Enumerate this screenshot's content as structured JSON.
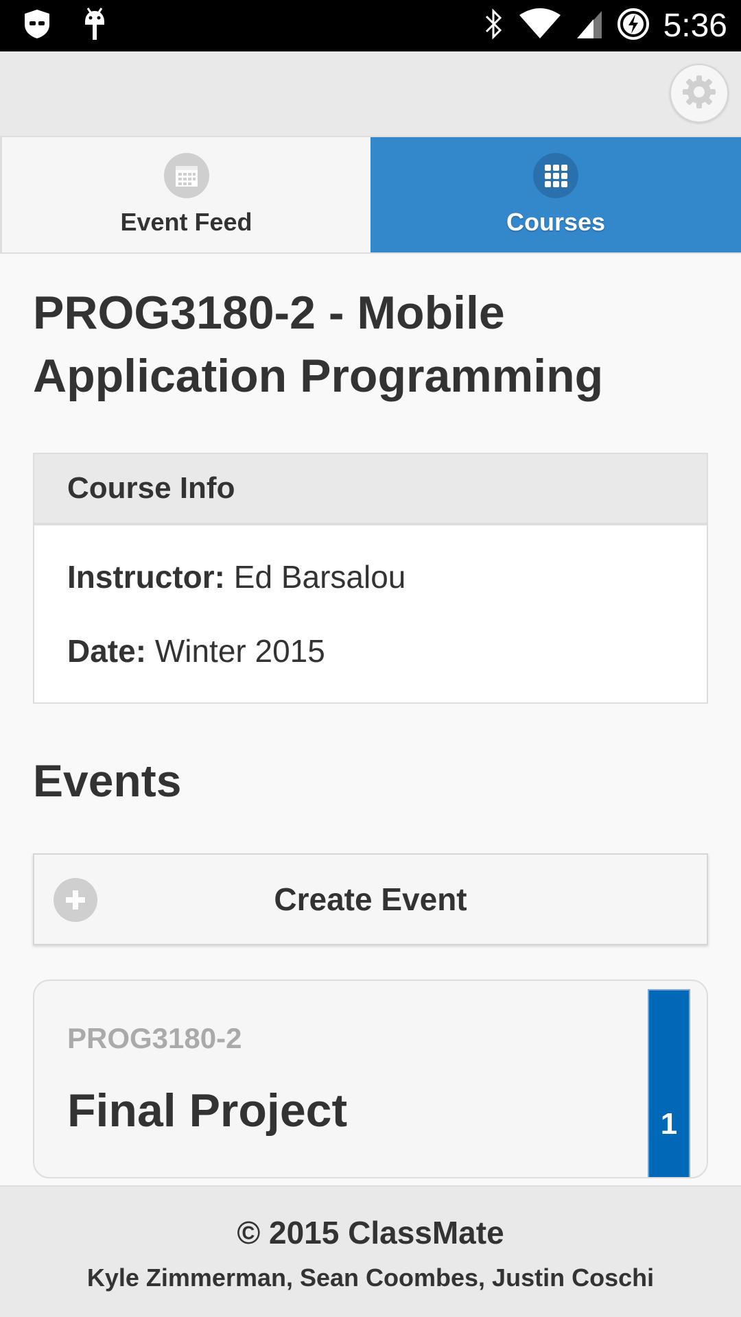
{
  "status_bar": {
    "time": "5:36",
    "icons": [
      "cyanogen-shield-icon",
      "android-icon",
      "bluetooth-icon",
      "wifi-icon",
      "signal-icon",
      "battery-charging-icon"
    ]
  },
  "header": {
    "settings_icon": "gear-icon"
  },
  "tabs": [
    {
      "label": "Event Feed",
      "icon": "calendar-icon",
      "active": false
    },
    {
      "label": "Courses",
      "icon": "grid-icon",
      "active": true
    }
  ],
  "colors": {
    "accent": "#3388cc",
    "badge": "#0068b6"
  },
  "course": {
    "title": "PROG3180-2 - Mobile Application Programming",
    "info_heading": "Course Info",
    "instructor_label": "Instructor:",
    "instructor": "Ed Barsalou",
    "date_label": "Date:",
    "date": "Winter 2015"
  },
  "events": {
    "heading": "Events",
    "create_label": "Create Event",
    "items": [
      {
        "course": "PROG3180-2",
        "name": "Final Project",
        "count": "1"
      }
    ]
  },
  "footer": {
    "copyright": "© 2015 ClassMate",
    "authors": "Kyle Zimmerman, Sean Coombes, Justin Coschi"
  }
}
